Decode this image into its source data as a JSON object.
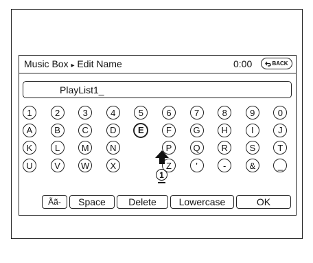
{
  "header": {
    "breadcrumb_parent": "Music Box",
    "breadcrumb_sep": "▸",
    "breadcrumb_current": "Edit Name",
    "time": "0:00",
    "back_label": "BACK"
  },
  "name_field": {
    "value": "PlayList1_"
  },
  "keyboard": {
    "rows": [
      [
        "1",
        "2",
        "3",
        "4",
        "5",
        "6",
        "7",
        "8",
        "9",
        "0"
      ],
      [
        "A",
        "B",
        "C",
        "D",
        "E",
        "F",
        "G",
        "H",
        "I",
        "J"
      ],
      [
        "K",
        "L",
        "M",
        "N",
        "",
        "P",
        "Q",
        "R",
        "S",
        "T"
      ],
      [
        "U",
        "V",
        "W",
        "X",
        "",
        "Z",
        "'",
        "-",
        "&",
        "_"
      ]
    ],
    "selected_key": "E",
    "cursor_marker": "1"
  },
  "bottom_buttons": {
    "accent": "Ãã-",
    "space": "Space",
    "delete": "Delete",
    "lowercase": "Lowercase",
    "ok": "OK"
  }
}
